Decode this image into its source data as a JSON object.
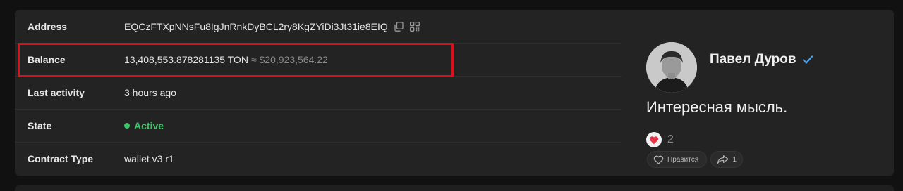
{
  "wallet": {
    "address_label": "Address",
    "address_value": "EQCzFTXpNNsFu8IgJnRnkDyBCL2ry8KgZYiDi3Jt31ie8EIQ",
    "balance_label": "Balance",
    "balance_ton": "13,408,553.878281135 TON",
    "balance_usd": "≈ $20,923,564.22",
    "last_activity_label": "Last activity",
    "last_activity_value": "3 hours ago",
    "state_label": "State",
    "state_value": "Active",
    "contract_type_label": "Contract Type",
    "contract_type_value": "wallet v3 r1"
  },
  "post": {
    "author": "Павел Дуров",
    "text": "Интересная мысль.",
    "reaction_count": "2",
    "like_label": "Нравится",
    "share_count": "1"
  },
  "colors": {
    "highlight": "#d8121d",
    "active": "#3ec467",
    "verified": "#4fa3ea",
    "heart": "#e8344a"
  }
}
